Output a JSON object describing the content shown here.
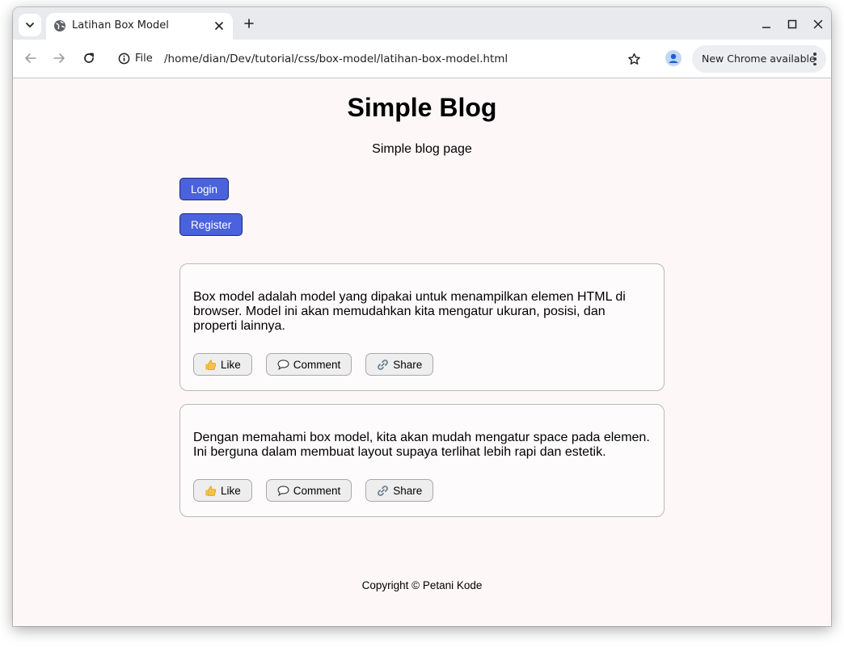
{
  "browser": {
    "tab_title": "Latihan Box Model",
    "site_info_label": "File",
    "url": "/home/dian/Dev/tutorial/css/box-model/latihan-box-model.html",
    "update_chip_label": "New Chrome available"
  },
  "page": {
    "title": "Simple Blog",
    "subtitle": "Simple blog page",
    "login_label": "Login",
    "register_label": "Register",
    "posts": [
      {
        "text": "Box model adalah model yang dipakai untuk menampilkan elemen HTML di browser. Model ini akan memudahkan kita mengatur ukuran, posisi, dan properti lainnya.",
        "like_label": "Like",
        "comment_label": "Comment",
        "share_label": "Share"
      },
      {
        "text": "Dengan memahami box model, kita akan mudah mengatur space pada elemen. Ini berguna dalam membuat layout supaya terlihat lebih rapi dan estetik.",
        "like_label": "Like",
        "comment_label": "Comment",
        "share_label": "Share"
      }
    ],
    "footer": "Copyright © Petani Kode"
  },
  "colors": {
    "primary_button": "#4a62dd",
    "page_background": "#fdf7f8"
  },
  "icons": {
    "like": "thumbs-up-icon",
    "comment": "speech-bubble-icon",
    "share": "link-icon"
  }
}
